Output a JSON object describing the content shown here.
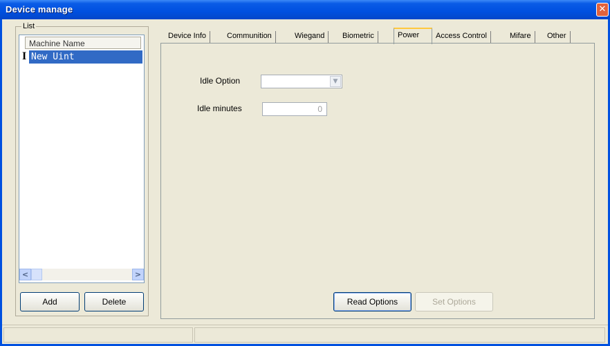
{
  "window": {
    "title": "Device manage"
  },
  "list": {
    "group_label": "List",
    "column_header": "Machine Name",
    "items": [
      {
        "icon": "I",
        "label": "New Uint",
        "selected": true
      }
    ]
  },
  "buttons": {
    "add": "Add",
    "delete": "Delete",
    "read_options": "Read Options",
    "set_options": "Set Options"
  },
  "tabs": [
    {
      "label": "Device Info"
    },
    {
      "label": "Communition"
    },
    {
      "label": "Wiegand"
    },
    {
      "label": "Biometric"
    },
    {
      "label": "Power",
      "active": true
    },
    {
      "label": "Access Control"
    },
    {
      "label": "Mifare"
    },
    {
      "label": "Other"
    }
  ],
  "power": {
    "idle_option_label": "Idle Option",
    "idle_option_value": "",
    "idle_minutes_label": "Idle minutes",
    "idle_minutes_value": "0"
  },
  "statusbar": {
    "panes": [
      "",
      ""
    ]
  },
  "colors": {
    "titlebar": "#0050e0",
    "selection": "#316ac5",
    "close": "#e2623c"
  }
}
